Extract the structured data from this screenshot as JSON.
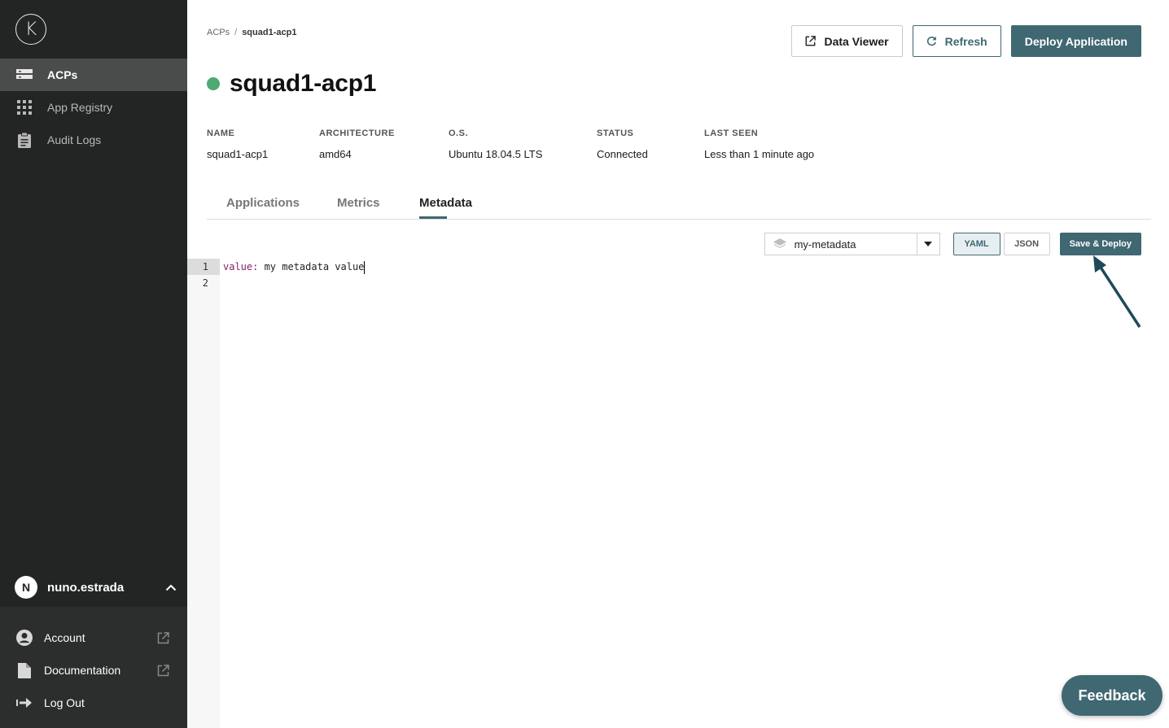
{
  "sidebar": {
    "logo_letter": "K",
    "nav": [
      {
        "label": "ACPs",
        "icon": "server-icon",
        "active": true
      },
      {
        "label": "App Registry",
        "icon": "grid-icon",
        "active": false
      },
      {
        "label": "Audit Logs",
        "icon": "clipboard-icon",
        "active": false
      }
    ],
    "user": {
      "initial": "N",
      "name": "nuno.estrada"
    },
    "bottom": [
      {
        "label": "Account",
        "icon": "user-circle-icon"
      },
      {
        "label": "Documentation",
        "icon": "document-icon"
      },
      {
        "label": "Log Out",
        "icon": "logout-icon"
      }
    ]
  },
  "breadcrumb": {
    "root": "ACPs",
    "separator": "/",
    "current": "squad1-acp1"
  },
  "actions": {
    "data_viewer": "Data Viewer",
    "refresh": "Refresh",
    "deploy": "Deploy Application"
  },
  "acp": {
    "title": "squad1-acp1",
    "status_color": "#4caa72",
    "info": [
      {
        "label": "NAME",
        "value": "squad1-acp1"
      },
      {
        "label": "ARCHITECTURE",
        "value": "amd64"
      },
      {
        "label": "O.S.",
        "value": "Ubuntu 18.04.5 LTS"
      },
      {
        "label": "STATUS",
        "value": "Connected"
      },
      {
        "label": "LAST SEEN",
        "value": "Less than 1 minute ago"
      }
    ]
  },
  "tabs": [
    {
      "label": "Applications",
      "active": false
    },
    {
      "label": "Metrics",
      "active": false
    },
    {
      "label": "Metadata",
      "active": true
    }
  ],
  "metadata_toolbar": {
    "selected": "my-metadata",
    "yaml": "YAML",
    "json": "JSON",
    "save": "Save & Deploy"
  },
  "editor": {
    "line_numbers": [
      "1",
      "2"
    ],
    "line1_key": "value:",
    "line1_value": " my metadata value"
  },
  "feedback": "Feedback",
  "colors": {
    "accent": "#3f6872",
    "sidebar": "#232525",
    "status": "#4caa72"
  }
}
